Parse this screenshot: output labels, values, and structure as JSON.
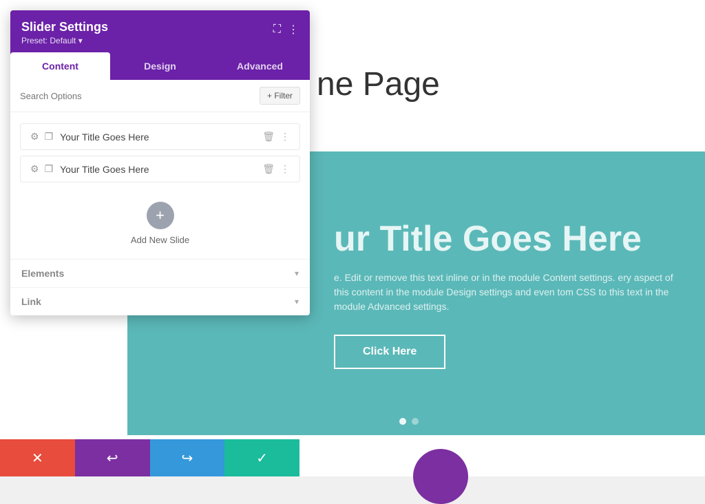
{
  "page": {
    "title": "ne Page"
  },
  "panel": {
    "title": "Slider Settings",
    "preset_label": "Preset: Default ▾",
    "tabs": [
      {
        "id": "content",
        "label": "Content",
        "active": true
      },
      {
        "id": "design",
        "label": "Design",
        "active": false
      },
      {
        "id": "advanced",
        "label": "Advanced",
        "active": false
      }
    ],
    "search_placeholder": "Search Options",
    "filter_label": "+ Filter",
    "slides": [
      {
        "label": "Your Title Goes Here"
      },
      {
        "label": "Your Title Goes Here"
      }
    ],
    "add_slide_label": "Add New Slide",
    "sections": [
      {
        "id": "elements",
        "label": "Elements"
      },
      {
        "id": "link",
        "label": "Link"
      }
    ]
  },
  "toolbar": {
    "cancel_icon": "✕",
    "undo_icon": "↩",
    "redo_icon": "↪",
    "confirm_icon": "✓"
  },
  "slider": {
    "title": "ur Title Goes Here",
    "body": "e. Edit or remove this text inline or in the module Content settings.\nery aspect of this content in the module Design settings and even\ntom CSS to this text in the module Advanced settings.",
    "button_label": "Click Here",
    "dots": [
      true,
      false
    ]
  }
}
